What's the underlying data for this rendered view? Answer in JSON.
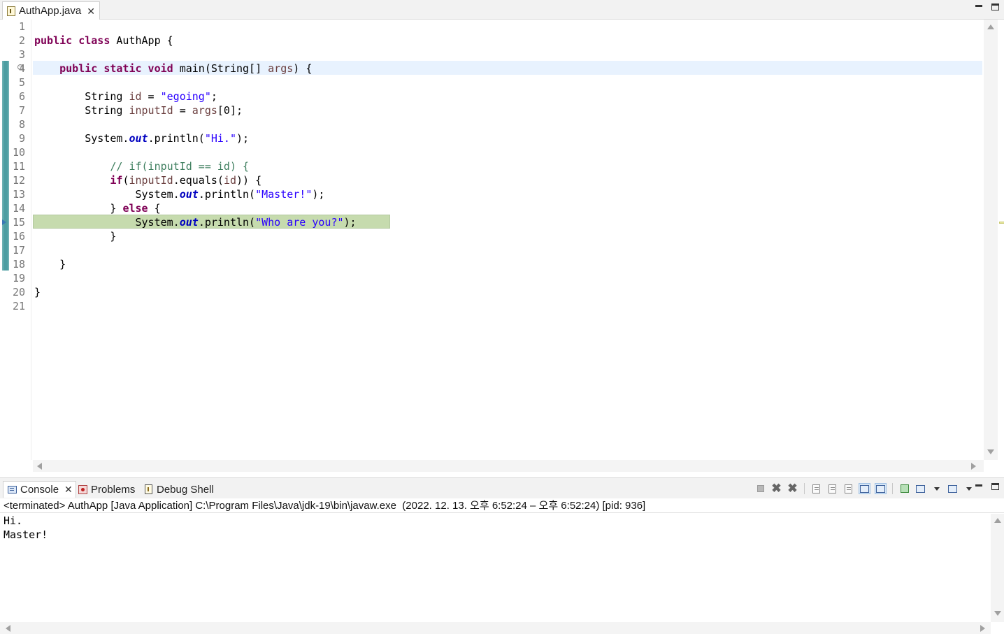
{
  "editor": {
    "tab_title": "AuthApp.java",
    "line_numbers": [
      "1",
      "2",
      "3",
      "4",
      "5",
      "6",
      "7",
      "8",
      "9",
      "10",
      "11",
      "12",
      "13",
      "14",
      "15",
      "16",
      "17",
      "18",
      "19",
      "20",
      "21"
    ],
    "current_line": 4,
    "debug_line": 15,
    "code_lines": [
      [],
      [
        {
          "t": "public class",
          "c": "kw"
        },
        {
          "t": " AuthApp {",
          "c": ""
        }
      ],
      [],
      [
        {
          "t": "    ",
          "c": ""
        },
        {
          "t": "public static void",
          "c": "kw"
        },
        {
          "t": " main(String[] ",
          "c": ""
        },
        {
          "t": "args",
          "c": "var"
        },
        {
          "t": ") {",
          "c": ""
        }
      ],
      [],
      [
        {
          "t": "        String ",
          "c": ""
        },
        {
          "t": "id",
          "c": "var"
        },
        {
          "t": " = ",
          "c": ""
        },
        {
          "t": "\"egoing\"",
          "c": "str"
        },
        {
          "t": ";",
          "c": ""
        }
      ],
      [
        {
          "t": "        String ",
          "c": ""
        },
        {
          "t": "inputId",
          "c": "var"
        },
        {
          "t": " = ",
          "c": ""
        },
        {
          "t": "args",
          "c": "var"
        },
        {
          "t": "[0];",
          "c": ""
        }
      ],
      [],
      [
        {
          "t": "        System.",
          "c": ""
        },
        {
          "t": "out",
          "c": "fld"
        },
        {
          "t": ".println(",
          "c": ""
        },
        {
          "t": "\"Hi.\"",
          "c": "str"
        },
        {
          "t": ");",
          "c": ""
        }
      ],
      [],
      [
        {
          "t": "            ",
          "c": ""
        },
        {
          "t": "// if(inputId == id) {",
          "c": "cmt"
        }
      ],
      [
        {
          "t": "            ",
          "c": ""
        },
        {
          "t": "if",
          "c": "kw"
        },
        {
          "t": "(",
          "c": ""
        },
        {
          "t": "inputId",
          "c": "var"
        },
        {
          "t": ".equals(",
          "c": ""
        },
        {
          "t": "id",
          "c": "var"
        },
        {
          "t": ")) {",
          "c": ""
        }
      ],
      [
        {
          "t": "                System.",
          "c": ""
        },
        {
          "t": "out",
          "c": "fld"
        },
        {
          "t": ".println(",
          "c": ""
        },
        {
          "t": "\"Master!\"",
          "c": "str"
        },
        {
          "t": ");",
          "c": ""
        }
      ],
      [
        {
          "t": "            } ",
          "c": ""
        },
        {
          "t": "else",
          "c": "kw"
        },
        {
          "t": " {",
          "c": ""
        }
      ],
      [
        {
          "t": "                System.",
          "c": ""
        },
        {
          "t": "out",
          "c": "fld"
        },
        {
          "t": ".println(",
          "c": ""
        },
        {
          "t": "\"Who are you?\"",
          "c": "str"
        },
        {
          "t": ");",
          "c": ""
        }
      ],
      [
        {
          "t": "            }",
          "c": ""
        }
      ],
      [],
      [
        {
          "t": "    }",
          "c": ""
        }
      ],
      [],
      [
        {
          "t": "}",
          "c": ""
        }
      ],
      []
    ]
  },
  "console_view": {
    "tabs": [
      {
        "label": "Console",
        "icon": "console-icon",
        "active": true
      },
      {
        "label": "Problems",
        "icon": "problems-icon",
        "active": false
      },
      {
        "label": "Debug Shell",
        "icon": "debug-shell-icon",
        "active": false
      }
    ],
    "status": "<terminated> AuthApp [Java Application] C:\\Program Files\\Java\\jdk-19\\bin\\javaw.exe  (2022. 12. 13. 오후 6:52:24 – 오후 6:52:24) [pid: 936]",
    "output_lines": [
      "Hi.",
      "Master!"
    ]
  },
  "colors": {
    "keyword": "#7f0055",
    "string": "#2a00ff",
    "local_variable": "#6a3e3e",
    "static_field": "#0000c0",
    "comment": "#3f7f5f",
    "current_line_bg": "#e8f2fe",
    "debug_line_bg": "#c6dbae"
  }
}
